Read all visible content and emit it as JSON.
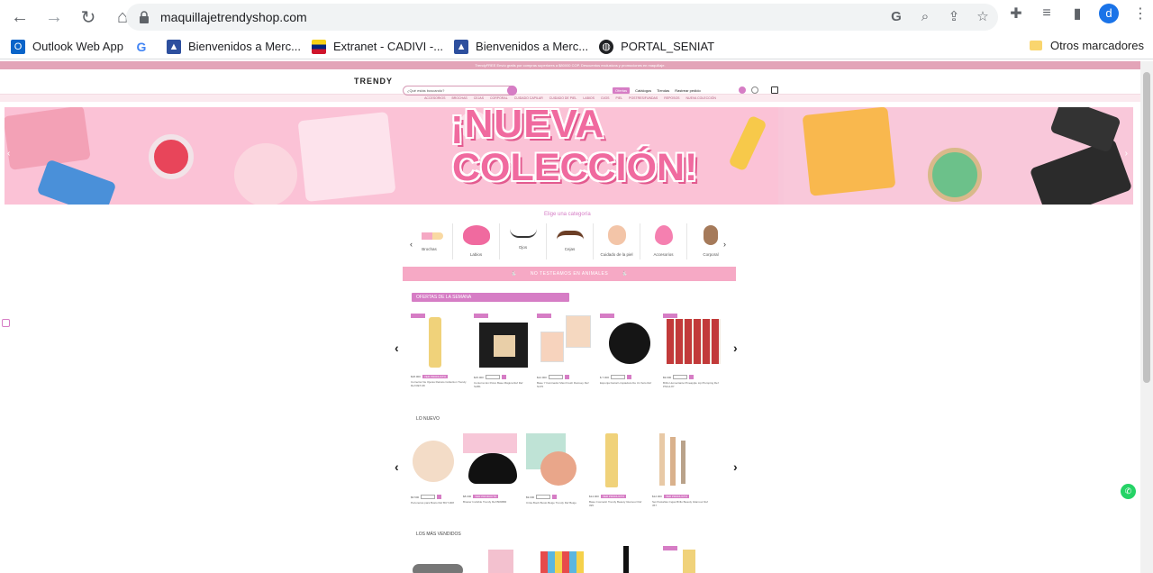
{
  "browser": {
    "url": "maquillajetrendyshop.com",
    "profile_initial": "d",
    "bookmarks": [
      {
        "label": "Outlook Web App",
        "icon": "outlook-icon",
        "color": "#0a64c9"
      },
      {
        "label": "",
        "icon": "google-icon",
        "color": "#4285f4"
      },
      {
        "label": "Bienvenidos a Merc...",
        "icon": "mercantil-icon",
        "color": "#2d4f9e"
      },
      {
        "label": "Extranet - CADIVI -...",
        "icon": "venezuela-flag-icon",
        "color": "#cf142b"
      },
      {
        "label": "Bienvenidos a Merc...",
        "icon": "mercantil-icon",
        "color": "#2d4f9e"
      },
      {
        "label": "PORTAL_SENIAT",
        "icon": "globe-icon",
        "color": "#202124"
      }
    ],
    "other_bookmarks": "Otros marcadores"
  },
  "shop": {
    "promo_bar": "TrendyFREE Envío gratis por compras superiores a $80000 COP. Descuentos exclusivos y promociones en maquillaje.",
    "logo": "TRENDY",
    "search_placeholder": "¿Qué estás buscando?",
    "top_menu": [
      "Ofertas",
      "Catálogos",
      "Tiendas",
      "Rastrear pedido"
    ],
    "category_menu": [
      "ACCESORIOS",
      "BROCHAS",
      "CEJAS",
      "CORPORAL",
      "CUIDADO CAPILAR",
      "CUIDADO DE PIEL",
      "LABIOS",
      "OJOS",
      "PIEL",
      "POSTRES/FUNDAS",
      "REPOSOS",
      "NUEVA COLECCIÓN"
    ],
    "banner_line1": "¡NUEVA",
    "banner_line2": "COLECCIÓN!",
    "category_heading": "Elige una categoría",
    "categories": [
      "Brochas",
      "Labios",
      "Ojos",
      "Cejas",
      "Cuidado de la piel",
      "Accesorios",
      "Corporal"
    ],
    "no_test_banner": "NO TESTEAMOS EN ANIMALES",
    "ofertas_title": "OFERTAS DE LA SEMANA",
    "lo_nuevo_title": "LO NUEVO",
    "mas_vendidos_title": "LOS MÁS VENDIDOS",
    "ver_producto": "VER PRODUCTO",
    "ofertas_products": [
      {
        "price": "$18.000",
        "name": "Corrector De Ojeras Retrato Collection Trendy Ref RET-08"
      },
      {
        "price": "$15.000",
        "name": "Contorno En Polvo Base Mágica Ref Ref SAB1"
      },
      {
        "price": "$12.000",
        "name": "Base Y Iluminador Maxi Fresh Ramsey Ref N470"
      },
      {
        "price": "$ 7.000",
        "name": "Esponja Facial Limpiadora De Un Solo Ref"
      },
      {
        "price": "$9.000",
        "name": "Brillo Humectante Pineapple Lip Plumping Ref PNG4-87"
      }
    ],
    "nuevo_products": [
      {
        "price": "$6.500",
        "name": "Pezoneras para Busto Ref BUT-008"
      },
      {
        "price": "$8.000",
        "name": "Brasier Invisible Trendy Ref BRMBR"
      },
      {
        "price": "$9.000",
        "name": "Cinta Boob Busto Beige Trendy Ref Beige"
      },
      {
        "price": "$14.000",
        "name": "Base Cosmetic Trendy Beauty Glamour Ref 095"
      },
      {
        "price": "$12.000",
        "name": "Set Pestañas Cejas Brillo Beauty Glamour Ref 357"
      }
    ]
  }
}
